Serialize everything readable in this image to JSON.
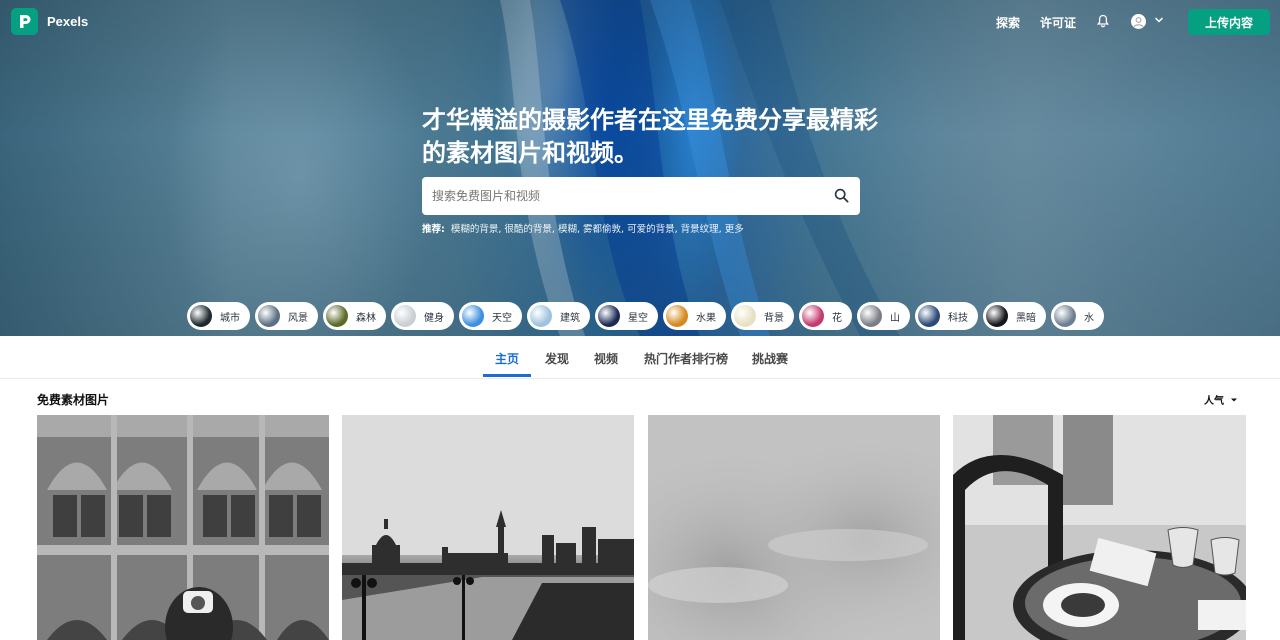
{
  "brand": {
    "name": "Pexels",
    "color": "#05a081"
  },
  "nav": {
    "explore": "探索",
    "license": "许可证",
    "upload": "上传内容"
  },
  "hero": {
    "title": "才华横溢的摄影作者在这里免费分享最精彩的素材图片和视频。",
    "search_placeholder": "搜索免费图片和视频",
    "suggest_label": "推荐:",
    "suggestions": [
      "模糊的背景",
      "很酷的背景",
      "模糊",
      "雾都偷敦",
      "可爱的背景",
      "背景纹理",
      "更多"
    ]
  },
  "chips": [
    {
      "label": "城市",
      "color": "#1e2a30"
    },
    {
      "label": "风景",
      "color": "#5b7083"
    },
    {
      "label": "森林",
      "color": "#5c6b2a"
    },
    {
      "label": "健身",
      "color": "#c9cfd3"
    },
    {
      "label": "天空",
      "color": "#3d8fe0"
    },
    {
      "label": "建筑",
      "color": "#9fc2e0"
    },
    {
      "label": "星空",
      "color": "#1b2a55"
    },
    {
      "label": "水果",
      "color": "#d48a1e"
    },
    {
      "label": "背景",
      "color": "#e8e0c4"
    },
    {
      "label": "花",
      "color": "#c43a6e"
    },
    {
      "label": "山",
      "color": "#7a7f86"
    },
    {
      "label": "科技",
      "color": "#2b4a78"
    },
    {
      "label": "黑暗",
      "color": "#14181c"
    },
    {
      "label": "水",
      "color": "#6f7f92"
    }
  ],
  "tabs": [
    {
      "label": "主页",
      "active": true
    },
    {
      "label": "发现",
      "active": false
    },
    {
      "label": "视频",
      "active": false
    },
    {
      "label": "热门作者排行榜",
      "active": false
    },
    {
      "label": "挑战赛",
      "active": false
    }
  ],
  "gallery": {
    "title": "免费素材图片",
    "sort_label": "人气"
  },
  "accent": "#1c6cd2"
}
